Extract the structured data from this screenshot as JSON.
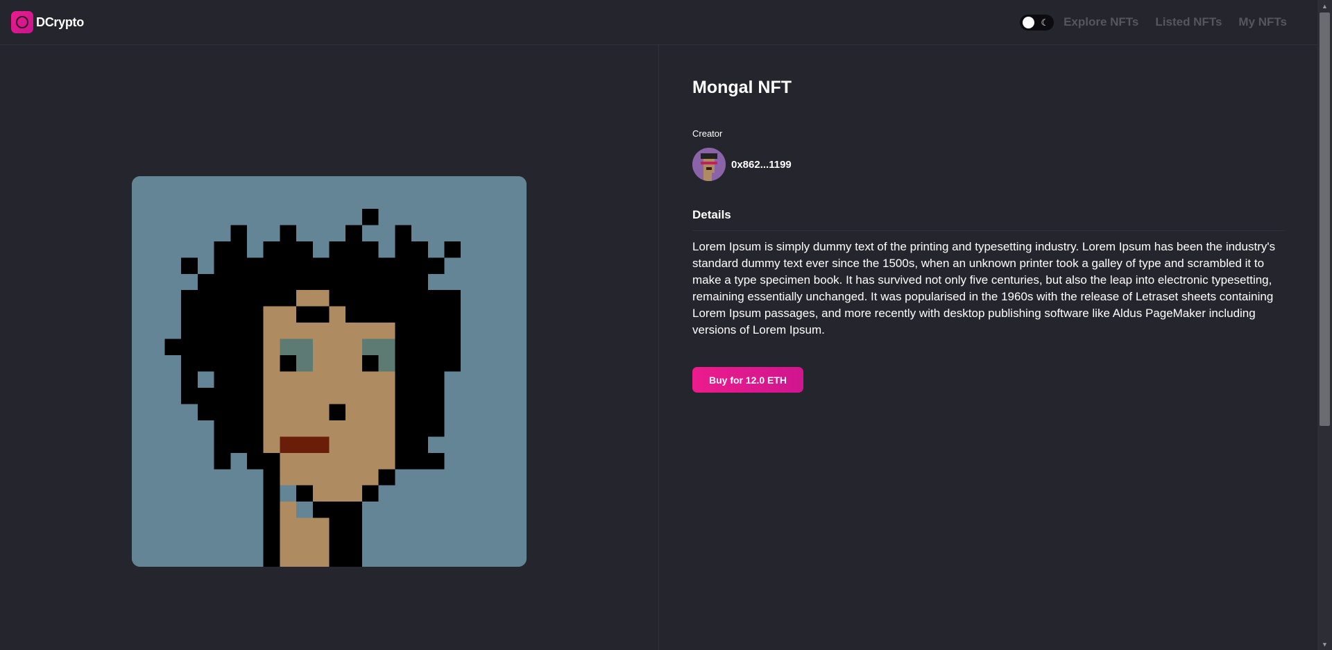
{
  "brand": {
    "name": "DCrypto",
    "logo_icon": "ring-logo-icon",
    "accent": "#ec1c8c"
  },
  "nav": {
    "theme_toggle_icon": "moon-icon",
    "items": [
      {
        "label": "Explore NFTs"
      },
      {
        "label": "Listed NFTs"
      },
      {
        "label": "My NFTs"
      }
    ]
  },
  "nft": {
    "title": "Mongal NFT",
    "creator_label": "Creator",
    "creator_address": "0x862...1199",
    "details_heading": "Details",
    "description": "Lorem Ipsum is simply dummy text of the printing and typesetting industry. Lorem Ipsum has been the industry's standard dummy text ever since the 1500s, when an unknown printer took a galley of type and scrambled it to make a type specimen book. It has survived not only five centuries, but also the leap into electronic typesetting, remaining essentially unchanged. It was popularised in the 1960s with the release of Letraset sheets containing Lorem Ipsum passages, and more recently with desktop publishing software like Aldus PageMaker including versions of Lorem Ipsum.",
    "buy_label": "Buy for 12.0 ETH"
  },
  "colors": {
    "background": "#24252d",
    "nav_text": "#55575f",
    "button_gradient_start": "#ec1c8c",
    "image_background": "#638596"
  }
}
